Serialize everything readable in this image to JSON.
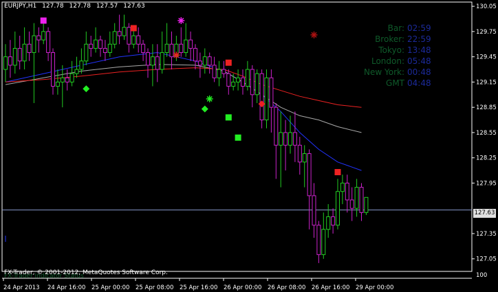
{
  "header": {
    "symbol": "EURJPY,H1",
    "open": "127.78",
    "high": "127.78",
    "low": "127.57",
    "close": "127.63"
  },
  "info_panel": [
    {
      "label": "Bar:",
      "value": "02:59"
    },
    {
      "label": "Broker:",
      "value": "22:59"
    },
    {
      "label": "Tokyo:",
      "value": "13:48"
    },
    {
      "label": "London:",
      "value": "05:48"
    },
    {
      "label": "New York:",
      "value": "00:48"
    },
    {
      "label": "GMT",
      "value": "04:48"
    }
  ],
  "copyright": "FX-Trader, © 2001-2012, MetaQuotes Software Corp.",
  "copyright_under": "FX-Trader   Indicator Status",
  "current_price": "127.63",
  "price_axis": [
    "130.05",
    "129.75",
    "129.45",
    "129.15",
    "128.85",
    "128.55",
    "128.25",
    "127.95",
    "127.35",
    "127.05"
  ],
  "time_axis": [
    "24 Apr 2013",
    "24 Apr 16:00",
    "25 Apr 00:00",
    "25 Apr 08:00",
    "25 Apr 16:00",
    "26 Apr 00:00",
    "26 Apr 08:00",
    "26 Apr 16:00",
    "29 Apr 00:00"
  ],
  "bottom_value": "100",
  "colors": {
    "background": "#000000",
    "bull_candle": "#22cc22",
    "bear_candle": "#cc22cc",
    "ma_fast": "#2233ff",
    "ma_mid": "#aaaaaa",
    "ma_slow": "#ee2222",
    "price_line": "#8899cc"
  },
  "chart_data": {
    "type": "candlestick",
    "symbol": "EURJPY",
    "timeframe": "H1",
    "ylim": [
      126.95,
      130.1
    ],
    "current": 127.63,
    "candles": [
      [
        129.3,
        129.45,
        129.6,
        129.15
      ],
      [
        129.45,
        129.35,
        129.65,
        129.2
      ],
      [
        129.35,
        129.55,
        129.75,
        129.25
      ],
      [
        129.55,
        129.4,
        129.7,
        129.3
      ],
      [
        129.4,
        129.6,
        129.8,
        129.3
      ],
      [
        129.6,
        129.5,
        129.75,
        129.4
      ],
      [
        129.5,
        129.7,
        129.85,
        128.9
      ],
      [
        129.7,
        129.65,
        129.8,
        129.5
      ],
      [
        129.65,
        129.75,
        129.9,
        129.6
      ],
      [
        129.75,
        129.5,
        129.8,
        129.4
      ],
      [
        129.5,
        129.1,
        129.55,
        129.0
      ],
      [
        129.1,
        129.15,
        129.3,
        129.0
      ],
      [
        129.15,
        129.2,
        129.35,
        128.85
      ],
      [
        129.2,
        129.15,
        129.3,
        129.05
      ],
      [
        129.15,
        129.25,
        129.4,
        129.1
      ],
      [
        129.25,
        129.3,
        129.45,
        129.2
      ],
      [
        129.3,
        129.4,
        129.55,
        129.25
      ],
      [
        129.4,
        129.6,
        129.75,
        129.35
      ],
      [
        129.6,
        129.55,
        129.7,
        129.45
      ],
      [
        129.55,
        129.65,
        129.8,
        129.5
      ],
      [
        129.65,
        129.55,
        129.7,
        129.45
      ],
      [
        129.55,
        129.5,
        129.65,
        129.4
      ],
      [
        129.5,
        129.6,
        129.75,
        129.45
      ],
      [
        129.6,
        129.75,
        129.85,
        129.55
      ],
      [
        129.75,
        129.7,
        129.95,
        129.6
      ],
      [
        129.7,
        129.8,
        129.95,
        129.65
      ],
      [
        129.8,
        129.6,
        129.85,
        129.5
      ],
      [
        129.6,
        129.7,
        129.8,
        129.55
      ],
      [
        129.7,
        129.6,
        129.8,
        129.5
      ],
      [
        129.6,
        129.5,
        129.65,
        129.4
      ],
      [
        129.5,
        129.35,
        129.55,
        129.2
      ],
      [
        129.35,
        129.45,
        129.6,
        129.1
      ],
      [
        129.45,
        129.3,
        129.6,
        129.15
      ],
      [
        129.3,
        129.5,
        129.75,
        129.25
      ],
      [
        129.5,
        129.6,
        129.85,
        129.45
      ],
      [
        129.6,
        129.45,
        129.75,
        129.3
      ],
      [
        129.45,
        129.6,
        129.7,
        129.4
      ],
      [
        129.6,
        129.5,
        129.8,
        129.45
      ],
      [
        129.5,
        129.65,
        129.85,
        129.45
      ],
      [
        129.65,
        129.55,
        129.75,
        129.4
      ],
      [
        129.55,
        129.4,
        129.6,
        129.3
      ],
      [
        129.4,
        129.35,
        129.5,
        129.2
      ],
      [
        129.35,
        129.45,
        129.55,
        129.25
      ],
      [
        129.45,
        129.35,
        129.5,
        129.25
      ],
      [
        129.35,
        129.2,
        129.45,
        129.15
      ],
      [
        129.2,
        129.3,
        129.4,
        129.1
      ],
      [
        129.3,
        129.25,
        129.4,
        129.2
      ],
      [
        129.25,
        129.1,
        129.3,
        129.0
      ],
      [
        129.1,
        129.15,
        129.25,
        129.05
      ],
      [
        129.15,
        129.2,
        129.3,
        129.05
      ],
      [
        129.2,
        129.1,
        129.3,
        129.0
      ],
      [
        129.1,
        129.3,
        129.4,
        129.05
      ],
      [
        129.3,
        129.0,
        129.35,
        128.85
      ],
      [
        129.0,
        129.25,
        129.3,
        128.9
      ],
      [
        129.25,
        128.7,
        129.3,
        128.6
      ],
      [
        128.7,
        129.2,
        129.3,
        128.6
      ],
      [
        129.2,
        128.85,
        129.3,
        128.55
      ],
      [
        128.85,
        128.4,
        128.9,
        128.0
      ],
      [
        128.4,
        128.55,
        128.8,
        127.9
      ],
      [
        128.55,
        128.4,
        128.7,
        128.1
      ],
      [
        128.4,
        128.55,
        128.75,
        128.3
      ],
      [
        128.55,
        128.4,
        128.8,
        128.2
      ],
      [
        128.4,
        128.2,
        128.5,
        128.05
      ],
      [
        128.2,
        128.3,
        128.4,
        127.9
      ],
      [
        128.3,
        127.8,
        128.35,
        127.4
      ],
      [
        127.8,
        127.45,
        127.95,
        127.3
      ],
      [
        127.45,
        127.1,
        127.5,
        127.0
      ],
      [
        127.1,
        127.4,
        127.6,
        127.05
      ],
      [
        127.4,
        127.55,
        127.7,
        127.3
      ],
      [
        127.55,
        127.45,
        127.65,
        127.35
      ],
      [
        127.45,
        127.85,
        128.0,
        127.4
      ],
      [
        127.85,
        127.95,
        128.05,
        127.7
      ],
      [
        127.95,
        127.75,
        128.05,
        127.6
      ],
      [
        127.75,
        127.65,
        127.9,
        127.5
      ],
      [
        127.65,
        127.9,
        128.0,
        127.55
      ],
      [
        127.9,
        127.6,
        127.95,
        127.5
      ],
      [
        127.6,
        127.78,
        127.78,
        127.57
      ]
    ],
    "ma_fast": [
      [
        0,
        129.15
      ],
      [
        8,
        129.25
      ],
      [
        16,
        129.35
      ],
      [
        24,
        129.45
      ],
      [
        32,
        129.5
      ],
      [
        40,
        129.4
      ],
      [
        46,
        129.28
      ],
      [
        50,
        129.15
      ],
      [
        54,
        129.0
      ],
      [
        58,
        128.8
      ],
      [
        62,
        128.55
      ],
      [
        66,
        128.35
      ],
      [
        70,
        128.2
      ],
      [
        75,
        128.1
      ]
    ],
    "ma_mid": [
      [
        0,
        129.12
      ],
      [
        8,
        129.2
      ],
      [
        16,
        129.28
      ],
      [
        24,
        129.33
      ],
      [
        32,
        129.36
      ],
      [
        40,
        129.35
      ],
      [
        46,
        129.28
      ],
      [
        50,
        129.15
      ],
      [
        54,
        129.0
      ],
      [
        58,
        128.85
      ],
      [
        62,
        128.75
      ],
      [
        66,
        128.7
      ],
      [
        70,
        128.62
      ],
      [
        75,
        128.55
      ]
    ],
    "ma_slow": [
      [
        0,
        129.15
      ],
      [
        8,
        129.18
      ],
      [
        16,
        129.22
      ],
      [
        24,
        129.27
      ],
      [
        32,
        129.3
      ],
      [
        40,
        129.32
      ],
      [
        46,
        129.3
      ],
      [
        50,
        129.22
      ],
      [
        54,
        129.12
      ],
      [
        58,
        129.05
      ],
      [
        62,
        128.98
      ],
      [
        66,
        128.93
      ],
      [
        70,
        128.88
      ],
      [
        75,
        128.85
      ]
    ],
    "signals": [
      {
        "shape": "square",
        "color": "#ee22ee",
        "i": 8,
        "y": 129.88
      },
      {
        "shape": "diamond",
        "color": "#22ee22",
        "i": 17,
        "y": 129.07
      },
      {
        "shape": "square",
        "color": "#ee2222",
        "i": 27,
        "y": 129.79
      },
      {
        "shape": "star",
        "color": "#ee22ee",
        "i": 37,
        "y": 129.88
      },
      {
        "shape": "star",
        "color": "#ee2222",
        "i": 36,
        "y": 129.47
      },
      {
        "shape": "star",
        "color": "#22ee22",
        "i": 43,
        "y": 128.95
      },
      {
        "shape": "diamond",
        "color": "#22ee22",
        "i": 42,
        "y": 128.83
      },
      {
        "shape": "square",
        "color": "#ee2222",
        "i": 47,
        "y": 129.38
      },
      {
        "shape": "square",
        "color": "#22ee22",
        "i": 47,
        "y": 128.73
      },
      {
        "shape": "square",
        "color": "#22ee22",
        "i": 49,
        "y": 128.49
      },
      {
        "shape": "diamond",
        "color": "#ee2222",
        "i": 54,
        "y": 128.89
      },
      {
        "shape": "star",
        "color": "#aa1111",
        "i": 65,
        "y": 129.71
      },
      {
        "shape": "square",
        "color": "#ee2222",
        "i": 70,
        "y": 128.08
      }
    ]
  }
}
